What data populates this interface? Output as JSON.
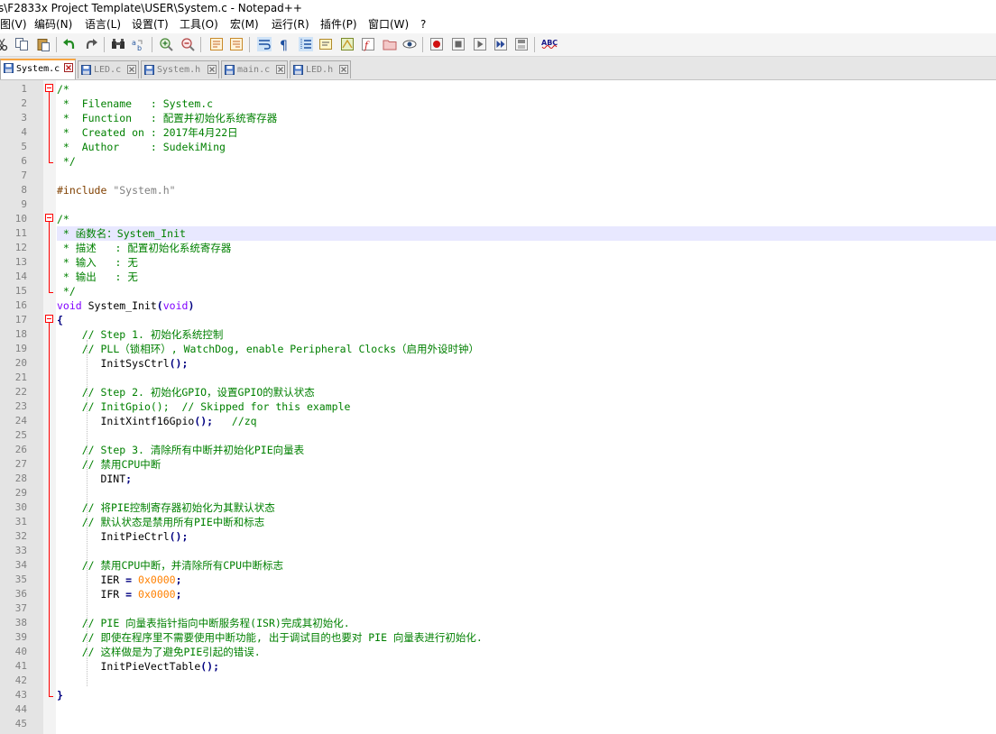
{
  "window": {
    "title": "s\\F2833x Project Template\\USER\\System.c - Notepad++"
  },
  "menu": [
    {
      "id": "view",
      "label": "图(V)"
    },
    {
      "id": "encoding",
      "label": "编码(N)"
    },
    {
      "id": "language",
      "label": "语言(L)"
    },
    {
      "id": "settings",
      "label": "设置(T)"
    },
    {
      "id": "tools",
      "label": "工具(O)"
    },
    {
      "id": "macro",
      "label": "宏(M)"
    },
    {
      "id": "run",
      "label": "运行(R)"
    },
    {
      "id": "plugins",
      "label": "插件(P)"
    },
    {
      "id": "window",
      "label": "窗口(W)"
    },
    {
      "id": "help",
      "label": "?"
    }
  ],
  "toolbar": {
    "spellcheck_label": "ABC"
  },
  "tabs": [
    {
      "label": "System.c",
      "active": true
    },
    {
      "label": "LED.c",
      "active": false
    },
    {
      "label": "System.h",
      "active": false
    },
    {
      "label": "main.c",
      "active": false
    },
    {
      "label": "LED.h",
      "active": false
    }
  ],
  "editor": {
    "current_line": 11,
    "lines": [
      {
        "n": "1",
        "t": [
          [
            "c",
            "/*"
          ]
        ]
      },
      {
        "n": "2",
        "t": [
          [
            "c",
            " *  Filename   : System.c"
          ]
        ]
      },
      {
        "n": "3",
        "t": [
          [
            "c",
            " *  Function   : 配置并初始化系统寄存器"
          ]
        ]
      },
      {
        "n": "4",
        "t": [
          [
            "c",
            " *  Created on : 2017年4月22日"
          ]
        ]
      },
      {
        "n": "5",
        "t": [
          [
            "c",
            " *  Author     : SudekiMing"
          ]
        ]
      },
      {
        "n": "6",
        "t": [
          [
            "c",
            " */"
          ]
        ]
      },
      {
        "n": "7",
        "t": []
      },
      {
        "n": "8",
        "t": [
          [
            "p",
            "#include "
          ],
          [
            "s",
            "\"System.h\""
          ]
        ]
      },
      {
        "n": "9",
        "t": []
      },
      {
        "n": "10",
        "t": [
          [
            "c",
            "/*"
          ]
        ]
      },
      {
        "n": "11",
        "t": [
          [
            "c",
            " * 函数名：System_Init"
          ]
        ]
      },
      {
        "n": "12",
        "t": [
          [
            "c",
            " * 描述   : 配置初始化系统寄存器"
          ]
        ]
      },
      {
        "n": "13",
        "t": [
          [
            "c",
            " * 输入   : 无"
          ]
        ]
      },
      {
        "n": "14",
        "t": [
          [
            "c",
            " * 输出   : 无"
          ]
        ]
      },
      {
        "n": "15",
        "t": [
          [
            "c",
            " */"
          ]
        ]
      },
      {
        "n": "16",
        "t": [
          [
            "k",
            "void"
          ],
          [
            "i",
            " System_Init"
          ],
          [
            "o",
            "("
          ],
          [
            "k",
            "void"
          ],
          [
            "o",
            ")"
          ]
        ]
      },
      {
        "n": "17",
        "t": [
          [
            "o",
            "{"
          ]
        ]
      },
      {
        "n": "18",
        "t": [
          [
            "i",
            "    "
          ],
          [
            "c",
            "// Step 1. 初始化系统控制"
          ]
        ]
      },
      {
        "n": "19",
        "t": [
          [
            "i",
            "    "
          ],
          [
            "c",
            "// PLL（锁相环）, WatchDog, enable Peripheral Clocks（启用外设时钟）"
          ]
        ]
      },
      {
        "n": "20",
        "t": [
          [
            "i",
            "       InitSysCtrl"
          ],
          [
            "o",
            "();"
          ]
        ]
      },
      {
        "n": "21",
        "t": []
      },
      {
        "n": "22",
        "t": [
          [
            "i",
            "    "
          ],
          [
            "c",
            "// Step 2. 初始化GPIO，设置GPIO的默认状态"
          ]
        ]
      },
      {
        "n": "23",
        "t": [
          [
            "i",
            "    "
          ],
          [
            "c",
            "// InitGpio();  // Skipped for this example"
          ]
        ]
      },
      {
        "n": "24",
        "t": [
          [
            "i",
            "       InitXintf16Gpio"
          ],
          [
            "o",
            "();"
          ],
          [
            "i",
            "   "
          ],
          [
            "c",
            "//zq"
          ]
        ]
      },
      {
        "n": "25",
        "t": []
      },
      {
        "n": "26",
        "t": [
          [
            "i",
            "    "
          ],
          [
            "c",
            "// Step 3. 清除所有中断并初始化PIE向量表"
          ]
        ]
      },
      {
        "n": "27",
        "t": [
          [
            "i",
            "    "
          ],
          [
            "c",
            "// 禁用CPU中断"
          ]
        ]
      },
      {
        "n": "28",
        "t": [
          [
            "i",
            "       DINT"
          ],
          [
            "o",
            ";"
          ]
        ]
      },
      {
        "n": "29",
        "t": []
      },
      {
        "n": "30",
        "t": [
          [
            "i",
            "    "
          ],
          [
            "c",
            "// 将PIE控制寄存器初始化为其默认状态"
          ]
        ]
      },
      {
        "n": "31",
        "t": [
          [
            "i",
            "    "
          ],
          [
            "c",
            "// 默认状态是禁用所有PIE中断和标志"
          ]
        ]
      },
      {
        "n": "32",
        "t": [
          [
            "i",
            "       InitPieCtrl"
          ],
          [
            "o",
            "();"
          ]
        ]
      },
      {
        "n": "33",
        "t": []
      },
      {
        "n": "34",
        "t": [
          [
            "i",
            "    "
          ],
          [
            "c",
            "// 禁用CPU中断，并清除所有CPU中断标志"
          ]
        ]
      },
      {
        "n": "35",
        "t": [
          [
            "i",
            "       IER "
          ],
          [
            "o",
            "="
          ],
          [
            "i",
            " "
          ],
          [
            "n",
            "0x0000"
          ],
          [
            "o",
            ";"
          ]
        ]
      },
      {
        "n": "36",
        "t": [
          [
            "i",
            "       IFR "
          ],
          [
            "o",
            "="
          ],
          [
            "i",
            " "
          ],
          [
            "n",
            "0x0000"
          ],
          [
            "o",
            ";"
          ]
        ]
      },
      {
        "n": "37",
        "t": []
      },
      {
        "n": "38",
        "t": [
          [
            "i",
            "    "
          ],
          [
            "c",
            "// PIE 向量表指针指向中断服务程(ISR)完成其初始化."
          ]
        ]
      },
      {
        "n": "39",
        "t": [
          [
            "i",
            "    "
          ],
          [
            "c",
            "// 即使在程序里不需要使用中断功能, 出于调试目的也要对 PIE 向量表进行初始化."
          ]
        ]
      },
      {
        "n": "40",
        "t": [
          [
            "i",
            "    "
          ],
          [
            "c",
            "// 这样做是为了避免PIE引起的错误."
          ]
        ]
      },
      {
        "n": "41",
        "t": [
          [
            "i",
            "       InitPieVectTable"
          ],
          [
            "o",
            "();"
          ]
        ]
      },
      {
        "n": "42",
        "t": []
      },
      {
        "n": "43",
        "t": [
          [
            "o",
            "}"
          ]
        ]
      },
      {
        "n": "44",
        "t": []
      },
      {
        "n": "45",
        "t": []
      }
    ]
  }
}
